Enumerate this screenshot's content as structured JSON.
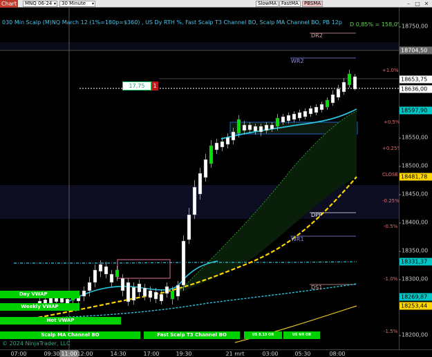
{
  "toolbar": {
    "chart_tab": "Chart",
    "instrument": "MNQ 06-24",
    "interval": "30 Minute",
    "buttons": [
      "SlowMA",
      "FastMA",
      "PBSMA"
    ],
    "window_controls": [
      "–",
      "□",
      "✕"
    ]
  },
  "chart": {
    "title": "030 Min Scalp (M)NQ March 12 (1%=180p=$360) , US Dy RTH %, Fast Scalp T3 Channel BO, Scalp MA Channel BO, PB 12p",
    "pnl": "D 0,85% = 158,0%",
    "copyright": "© 2024 NinjaTrader, LLC",
    "order_price": "17,75",
    "order_qty": "1",
    "levels": [
      {
        "label": "DR2",
        "color": "#e0a0a0"
      },
      {
        "label": "WR2",
        "color": "#8e8eee"
      },
      {
        "label": "DPP",
        "color": "#f0f0f0"
      },
      {
        "label": "WR1",
        "color": "#8e8eee"
      },
      {
        "label": "DS1",
        "color": "#e0a0a0"
      }
    ],
    "pct_labels": [
      "+1.0%",
      "+0.5%",
      "+0.25%",
      "CLOSE",
      "-0.25%",
      "-0.5%",
      "-1.0%",
      "-1.5%"
    ],
    "bottom_labels": [
      "Day VWAP",
      "Weekly VWAP",
      "Hot VWAP",
      "Scalp MA Channel BO",
      "Fast Scalp T3 Channel BO",
      "US 8.15 OR",
      "US NR OR"
    ]
  },
  "x_axis": [
    "07:00",
    "09:30",
    "11:00",
    "12:00",
    "14:30",
    "17:00",
    "19:30",
    "21 mrt",
    "03:00",
    "05:30",
    "08:00"
  ],
  "x_highlight": "11:00",
  "y_axis": [
    "18750,00",
    "18550,00",
    "18500,00",
    "18450,00",
    "18400,00",
    "18350,00",
    "18300,00",
    "18200,00"
  ],
  "y_markers": [
    {
      "text": "18704,50",
      "bg": "#6a6a6a",
      "fg": "#ffffff"
    },
    {
      "text": "18653,75",
      "bg": "#ffffff",
      "fg": "#000000"
    },
    {
      "text": "18636,00",
      "bg": "#ffffff",
      "fg": "#000000"
    },
    {
      "text": "18597,90",
      "bg": "#00c6c6",
      "fg": "#000000"
    },
    {
      "text": "18481,78",
      "bg": "#ffd700",
      "fg": "#000000"
    },
    {
      "text": "18331,37",
      "bg": "#00c6c6",
      "fg": "#000000"
    },
    {
      "text": "18269,87",
      "bg": "#00c6c6",
      "fg": "#000000"
    },
    {
      "text": "18253,44",
      "bg": "#ffd700",
      "fg": "#000000"
    }
  ],
  "colors": {
    "title": "#48c4e8",
    "candle_up": "#ffffff",
    "candle_breakout": "#00e000",
    "fast_ma": "#28c8e0",
    "slow_ma": "#ffd700",
    "channel": "#28c8e0"
  }
}
